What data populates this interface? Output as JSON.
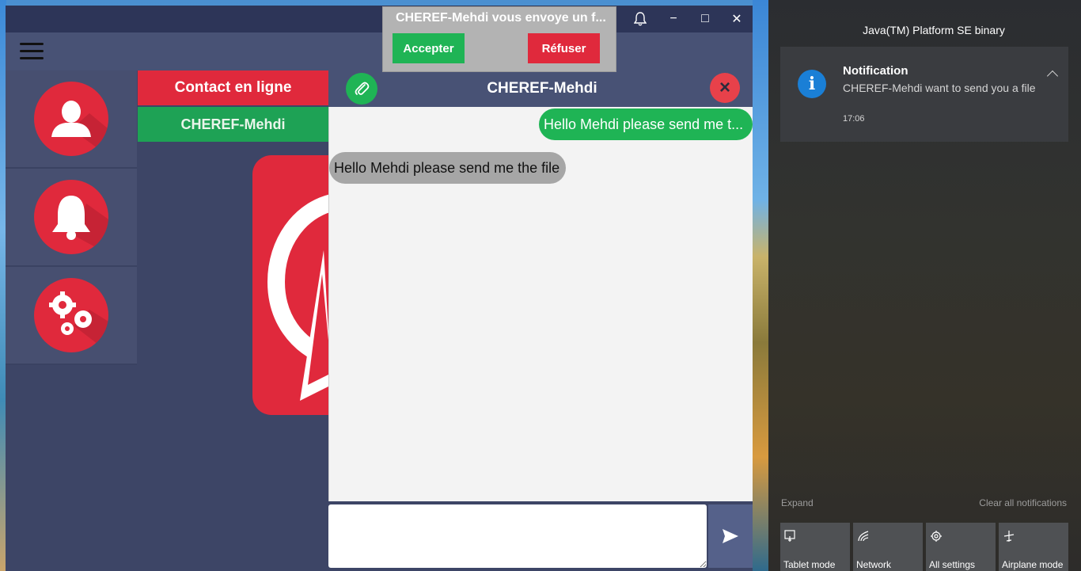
{
  "window": {
    "bell_icon": "bell-icon",
    "minimize_label": "−",
    "maximize_label": "□",
    "close_label": "✕"
  },
  "sidebar": {
    "items": [
      {
        "name": "contacts",
        "icon": "user-icon"
      },
      {
        "name": "notifications",
        "icon": "bell-icon"
      },
      {
        "name": "settings",
        "icon": "gears-icon"
      }
    ]
  },
  "contacts": {
    "header": "Contact en ligne",
    "items": [
      "CHEREF-Mehdi"
    ]
  },
  "chat": {
    "title": "CHEREF-Mehdi",
    "messages": [
      {
        "direction": "out",
        "text": "Hello Mehdi please send me t..."
      },
      {
        "direction": "in",
        "text": "Hello Mehdi please send me the file"
      }
    ],
    "input_value": ""
  },
  "popup": {
    "title": "CHEREF-Mehdi vous envoye un f...",
    "accept_label": "Accepter",
    "refuse_label": "Réfuser"
  },
  "action_center": {
    "app_name": "Java(TM) Platform SE binary",
    "notification": {
      "title": "Notification",
      "body": "CHEREF-Mehdi want to send you a file",
      "time": "17:06"
    },
    "expand_label": "Expand",
    "clear_label": "Clear all notifications",
    "quick_actions": [
      {
        "label": "Tablet mode",
        "icon": "tablet-icon"
      },
      {
        "label": "Network",
        "icon": "network-icon"
      },
      {
        "label": "All settings",
        "icon": "settings-icon"
      },
      {
        "label": "Airplane mode",
        "icon": "airplane-icon"
      }
    ]
  },
  "colors": {
    "accent_red": "#e0293c",
    "accent_green": "#1fb455",
    "panel": "#485275",
    "background": "#3d4566"
  }
}
